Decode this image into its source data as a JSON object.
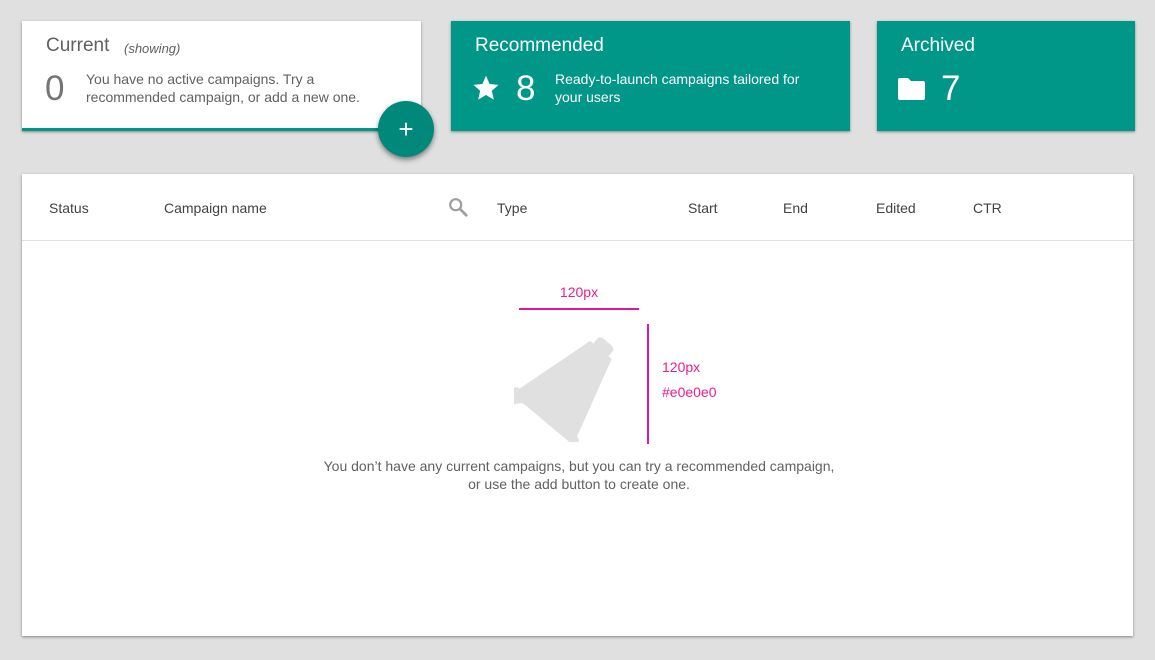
{
  "cards": {
    "current": {
      "title": "Current",
      "subtitle": "(showing)",
      "count": "0",
      "description": "You have no active campaigns.  Try a recommended campaign, or add a new one."
    },
    "recommended": {
      "title": "Recommended",
      "icon": "star-icon",
      "count": "8",
      "description": "Ready-to-launch campaigns tailored for your users"
    },
    "archived": {
      "title": "Archived",
      "icon": "folder-icon",
      "count": "7"
    }
  },
  "fab": {
    "label": "+",
    "icon": "add-icon"
  },
  "table": {
    "columns": [
      "Status",
      "Campaign name",
      "Type",
      "Start",
      "End",
      "Edited",
      "CTR"
    ],
    "search_icon": "search-icon",
    "empty_state": {
      "icon": "megaphone-icon",
      "message": "You don’t have any current campaigns, but you can try a recommended campaign, or use the add button to create one."
    }
  },
  "annotations": {
    "width_label": "120px",
    "height_label": "120px",
    "color_label": "#e0e0e0"
  },
  "colors": {
    "accent": "#009688",
    "fab": "#00897b",
    "background": "#e0e0e0",
    "empty_icon": "#e0e0e0",
    "annotation": "#e0179c"
  }
}
